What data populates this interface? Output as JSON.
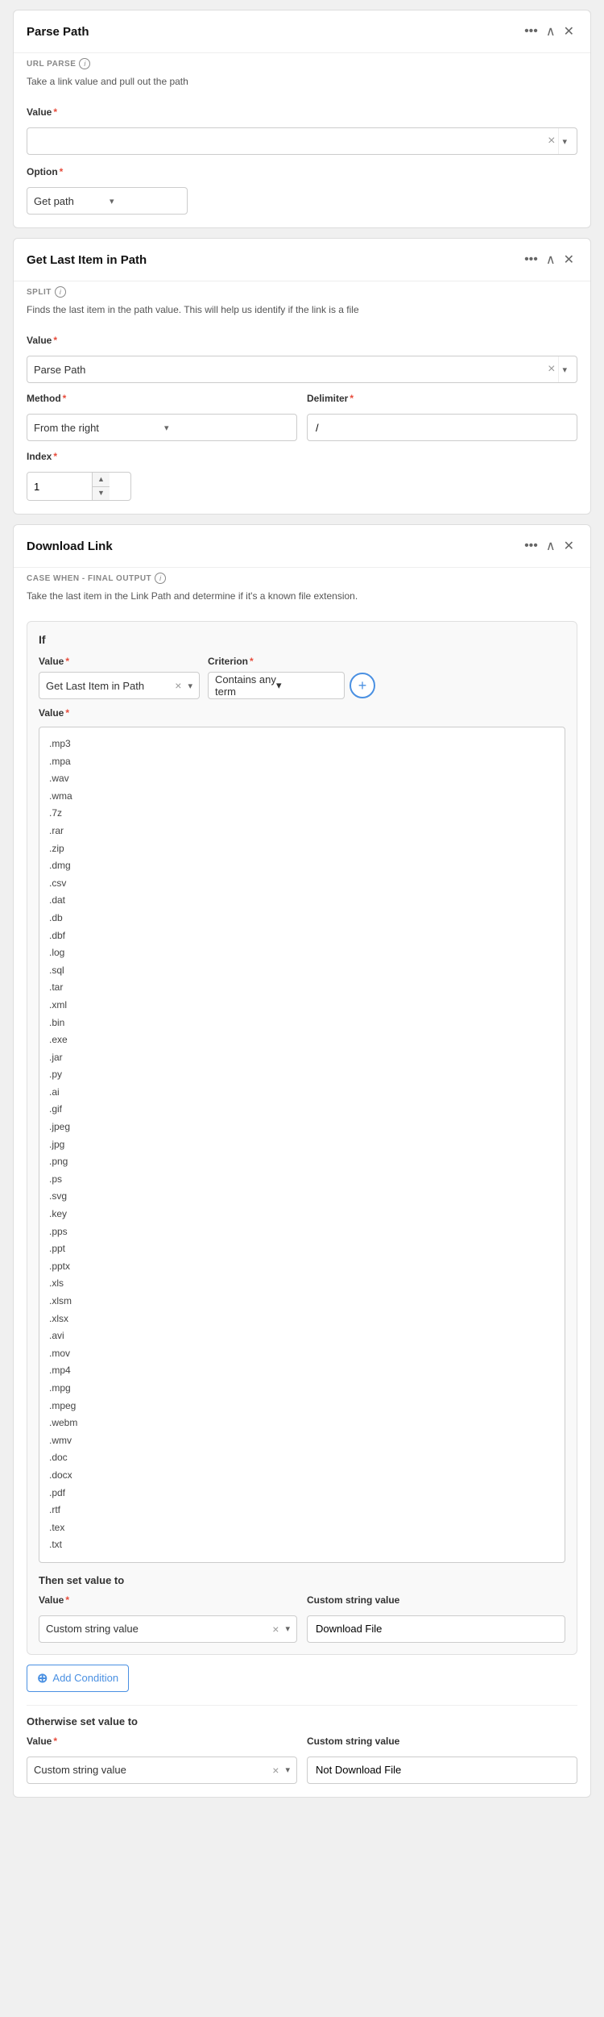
{
  "parse_path_card": {
    "title": "Parse Path",
    "subtitle": "URL PARSE",
    "description": "Take a link value and pull out the path",
    "value_label": "Value",
    "option_label": "Option",
    "option_value": "Get path",
    "option_placeholder": ""
  },
  "get_last_item_card": {
    "title": "Get Last Item in Path",
    "subtitle": "SPLIT",
    "description": "Finds the last item in the path value. This will help us identify if the link is a file",
    "value_label": "Value",
    "value_tag": "Parse Path",
    "method_label": "Method",
    "method_value": "From the right",
    "delimiter_label": "Delimiter",
    "delimiter_value": "/",
    "index_label": "Index",
    "index_value": "1"
  },
  "download_link_card": {
    "title": "Download Link",
    "subtitle": "CASE WHEN - FINAL OUTPUT",
    "description": "Take the last item in the Link Path and determine if it's a known file extension.",
    "if_label": "If",
    "value_label": "Value",
    "value_tag": "Get Last Item in Path",
    "criterion_label": "Criterion",
    "criterion_value": "Contains any term",
    "value_list_label": "Value",
    "file_extensions": [
      ".mp3",
      ".mpa",
      ".wav",
      ".wma",
      ".7z",
      ".rar",
      ".zip",
      ".dmg",
      ".csv",
      ".dat",
      ".db",
      ".dbf",
      ".log",
      ".sql",
      ".tar",
      ".xml",
      ".bin",
      ".exe",
      ".jar",
      ".py",
      ".ai",
      ".gif",
      ".jpeg",
      ".jpg",
      ".png",
      ".ps",
      ".svg",
      ".key",
      ".pps",
      ".ppt",
      ".pptx",
      ".xls",
      ".xlsm",
      ".xlsx",
      ".avi",
      ".mov",
      ".mp4",
      ".mpg",
      ".mpeg",
      ".webm",
      ".wmv",
      ".doc",
      ".docx",
      ".pdf",
      ".rtf",
      ".tex",
      ".txt"
    ],
    "then_label": "Then set value to",
    "then_value_label": "Value",
    "then_value_tag": "Custom string value",
    "then_custom_label": "Custom string value",
    "then_custom_value": "Download File",
    "add_condition_label": "Add Condition",
    "otherwise_label": "Otherwise set value to",
    "otherwise_value_label": "Value",
    "otherwise_value_tag": "Custom string value",
    "otherwise_custom_label": "Custom string value",
    "otherwise_custom_value": "Not Download File"
  }
}
